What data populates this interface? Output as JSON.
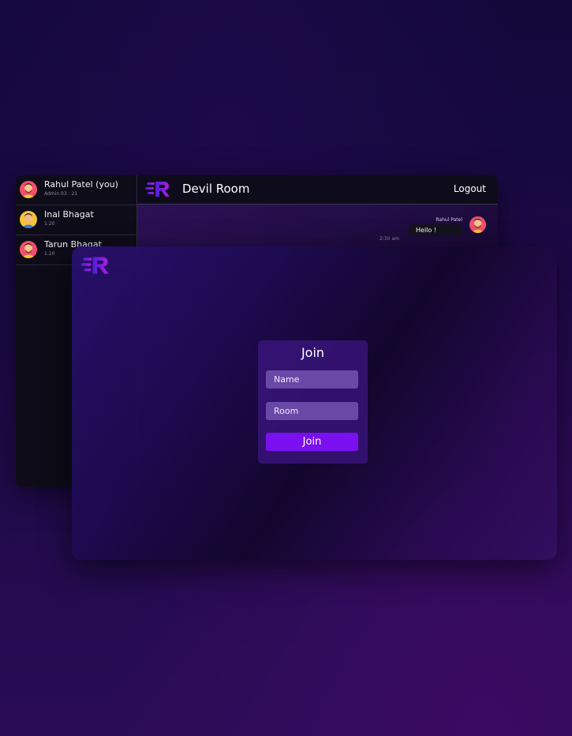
{
  "chat": {
    "room_title": "Devil Room",
    "logout_label": "Logout",
    "users": [
      {
        "name": "Rahul Patel (you)",
        "sub": "Admin 03 : 21",
        "avatar": "avatar-red"
      },
      {
        "name": "Inal Bhagat",
        "sub": "1:20",
        "avatar": "avatar-blue"
      },
      {
        "name": "Tarun Bhagat",
        "sub": "1:20",
        "avatar": "avatar-red"
      }
    ],
    "message": {
      "sender": "Rahul Patel",
      "text": "Hello !",
      "time": "2:30 am"
    }
  },
  "join": {
    "title": "Join",
    "name_placeholder": "Name",
    "room_placeholder": "Room",
    "button_label": "Join"
  },
  "colors": {
    "accent": "#7a10f0",
    "logo_gradient": [
      "#4b1fd6",
      "#b01ee0"
    ],
    "background": "#1a0a45"
  },
  "icons": {
    "logo": "r-speed-logo-icon",
    "avatar": "user-avatar-icon"
  }
}
